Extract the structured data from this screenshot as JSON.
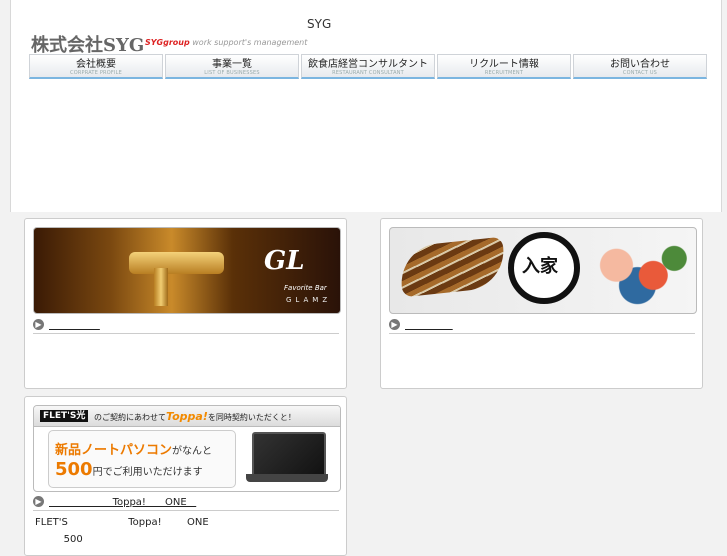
{
  "header": {
    "site_name": "SYG",
    "logo": "株式会社SYG",
    "tagline_brand": "SYGgroup",
    "tagline_rest": " work support's management"
  },
  "nav": [
    {
      "label": "会社概要",
      "sub": "CORPRATE PROFILE"
    },
    {
      "label": "事業一覧",
      "sub": "LIST OF BUSINESSES"
    },
    {
      "label": "飲食店経営コンサルタント",
      "sub": "RESTAURANT CONSULTANT"
    },
    {
      "label": "リクルート情報",
      "sub": "RECRUITMENT"
    },
    {
      "label": "お問い合わせ",
      "sub": "CONTACT US"
    }
  ],
  "cards": {
    "glamz": {
      "banner_logo": "GL",
      "banner_sub1": "Favorite Bar",
      "banner_sub2": "GLAMZ",
      "link": "                "
    },
    "iriya": {
      "banner_kanji": "入家",
      "link": "               "
    },
    "toppa": {
      "flets": "FLET'S光",
      "bar_pre": "のご契約にあわせて",
      "toppa_logo": "Toppa!",
      "bar_post": "を同時契約いただくと！",
      "line1_main": "新品ノートパソコン",
      "line1_small": "がなんと",
      "price": "500",
      "price_unit": "円",
      "line2_rest": "でご利用いただけます",
      "link": "                    Toppa!      ONE   ",
      "desc_line1": "FLET'S                   Toppa!        ONE",
      "desc_line2": "         500"
    }
  }
}
